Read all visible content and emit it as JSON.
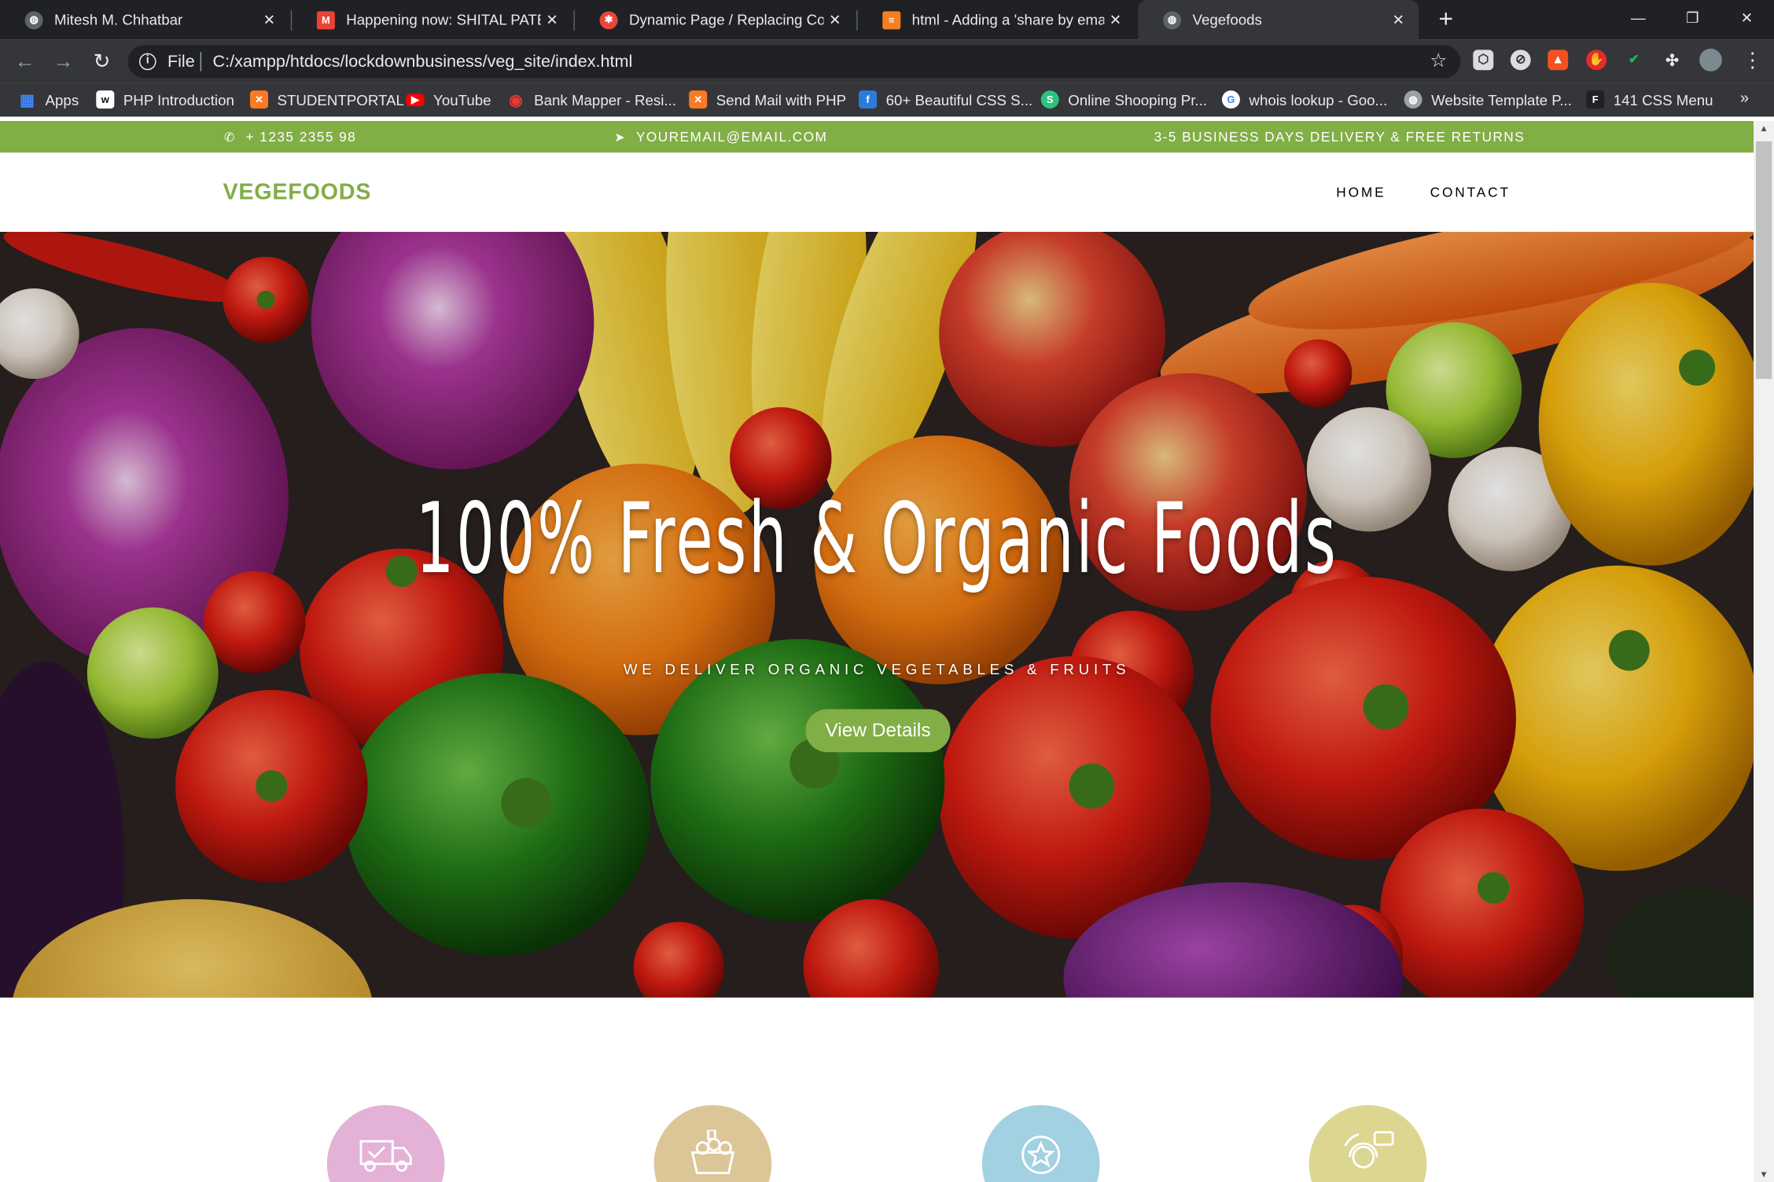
{
  "browser": {
    "tabs": [
      {
        "title": "Mitesh M. Chhatbar",
        "icon": "globe-icon",
        "color": "#5f6368"
      },
      {
        "title": "Happening now: SHITAL PATEL is",
        "icon": "gmail-icon",
        "color": "#ea4335"
      },
      {
        "title": "Dynamic Page / Replacing Conte",
        "icon": "codepen-icon",
        "color": "#e8453c"
      },
      {
        "title": "html - Adding a 'share by email' l",
        "icon": "stackoverflow-icon",
        "color": "#f48024"
      },
      {
        "title": "Vegefoods",
        "icon": "globe-icon",
        "color": "#5f6368"
      }
    ],
    "active_tab": 4,
    "new_tab_symbol": "+",
    "window_controls": {
      "minimize": "—",
      "restore": "❐",
      "close": "✕"
    },
    "address_bar": {
      "scheme_label": "File",
      "url": "C:/xampp/htdocs/lockdownbusiness/veg_site/index.html"
    },
    "bookmarks": [
      {
        "label": "Apps",
        "icon": "apps-grid-icon",
        "color": "#4285f4"
      },
      {
        "label": "PHP Introduction",
        "icon": "w3schools-icon",
        "color": "#ffffff"
      },
      {
        "label": "STUDENTPORTAL",
        "icon": "xampp-icon",
        "color": "#fb7a24"
      },
      {
        "label": "YouTube",
        "icon": "youtube-icon",
        "color": "#ff0000"
      },
      {
        "label": "Bank Mapper - Resi...",
        "icon": "bankmapper-icon",
        "color": "#e53935"
      },
      {
        "label": "Send Mail with PHP",
        "icon": "xampp-icon",
        "color": "#fb7a24"
      },
      {
        "label": "60+ Beautiful CSS S...",
        "icon": "freefrontend-icon",
        "color": "#2b7bdb"
      },
      {
        "label": "Online Shooping Pr...",
        "icon": "sourcecodester-icon",
        "color": "#2ec27e"
      },
      {
        "label": "whois lookup - Goo...",
        "icon": "google-icon",
        "color": "#ffffff"
      },
      {
        "label": "Website Template P...",
        "icon": "globe-icon",
        "color": "#9aa0a6"
      },
      {
        "label": "141 CSS Menu",
        "icon": "f-letter-icon",
        "color": "#202124"
      }
    ],
    "bookmarks_overflow": "»"
  },
  "site": {
    "topbar": {
      "phone": "+ 1235 2355 98",
      "email": "YOUREMAIL@EMAIL.COM",
      "delivery": "3-5 BUSINESS DAYS DELIVERY & FREE RETURNS"
    },
    "brand": "VEGEFOODS",
    "nav": [
      "HOME",
      "CONTACT"
    ],
    "hero": {
      "title": "100% Fresh & Organic Foods",
      "subtitle": "WE DELIVER ORGANIC VEGETABLES & FRUITS",
      "button": "View Details"
    },
    "services": [
      {
        "icon": "delivery-truck-icon",
        "color": "#e4b2d6"
      },
      {
        "icon": "fresh-basket-icon",
        "color": "#dcc698"
      },
      {
        "icon": "quality-badge-icon",
        "color": "#a2d1e1"
      },
      {
        "icon": "customer-support-icon",
        "color": "#dcd691"
      }
    ],
    "accent_color": "#82ae46"
  }
}
